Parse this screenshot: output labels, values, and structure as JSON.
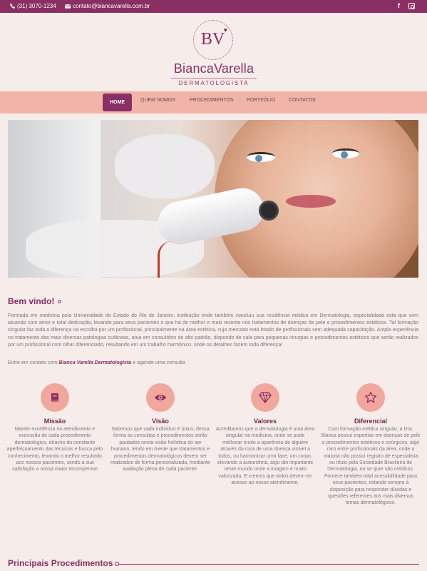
{
  "topbar": {
    "phone": "(31) 3070-1234",
    "email": "contato@biancavarella.com.br",
    "social": {
      "facebook": "f",
      "instagram": ""
    }
  },
  "brand": {
    "monogram": "BV",
    "name": "BiancaVarella",
    "subtitle": "DERMATOLOGISTA"
  },
  "nav": {
    "items": [
      {
        "label": "HOME",
        "active": true
      },
      {
        "label": "QUEM SOMOS"
      },
      {
        "label": "PROCEDIMENTOS"
      },
      {
        "label": "PORTFÓLIO"
      },
      {
        "label": "CONTATOS"
      }
    ]
  },
  "welcome": {
    "title": "Bem vindo!",
    "text": "Formada em medicina pela Universidade do Estado do Rio de Janeiro, instituição onde também concluiu sua residência médica em Dermatologia, especialidade esta que vem atuando com amor e total dedicação, levando para seus pacientes o que há de melhor e mais recente nos tratamentos de doenças da pele e procedimentos estéticos. Tal formação singular faz toda a diferença na escolha por um profissional, principalmente na área estética, cujo mercado está lotado de profissionais sem adequada capacitação. Ampla experiência no tratamento das mais diversas patologias cutâneas, atua em consultório de alto padrão, dispondo de sala para pequenas cirurgias e procedimentos estéticos que serão realizados por um profissional com olhar diferenciado, resultando em um trabalho harmônico, onde os detalhes fazem toda diferença!",
    "contact_prefix": "Entre em contato com ",
    "contact_name": "Bianca Varella Dermatologista",
    "contact_suffix": " e agende uma consulta"
  },
  "features": [
    {
      "icon": "book-icon",
      "title": "Missão",
      "text": "Manter excelência no atendimento e execução de cada procedimento dermatológico, através do constante aperfeiçoamento das técnicas e busca pelo conhecimento, levando o melhor resultado aos nossos pacientes, sendo a sua satisfação a nossa maior recompensa!"
    },
    {
      "icon": "eye-icon",
      "title": "Visão",
      "text": "Sabemos que cada indivíduo é único, dessa forma as consultas e procedimentos serão pautados nesta visão holística do ser humano, tendo em mente que tratamentos e procedimentos dermatológicos devem ser realizados de forma personalizada, mediante avaliação plena de cada paciente."
    },
    {
      "icon": "diamond-icon",
      "title": "Valores",
      "text": "Acreditamos que a dermatologia é uma área singular na medicina, onde se pode melhorar muito a aparência de alguém através da cura de uma doença visível a todos, ou harmonizar uma face, um corpo, elevando a autoestima, algo tão importante neste mundo onde a imagem é muito valorizada. E cremos que todos devem ter acesso ao nosso atendimento."
    },
    {
      "icon": "star-icon",
      "title": "Diferencial",
      "text": "Com formação médica singular, a Dra. Bianca possui expertise em doenças de pele e procedimentos estéticos e cirúrgicos, algo raro entre profissionais da área, onde a maioria não possui registro de especialista ou título pela Sociedade Brasileira de Dermatologia, ou se quer são médicos. Fornece também total acessibilidade para seus pacientes, estando sempre à disposição para responder dúvidas e questões referentes aos mais diversos temas dermatológicos."
    }
  ],
  "procedures": {
    "title": "Principais Procedimentos"
  },
  "colors": {
    "brand": "#8a2f63",
    "nav": "#f1b4a8",
    "icon_bg": "#f1a79d",
    "page_bg": "#f6ecea"
  }
}
